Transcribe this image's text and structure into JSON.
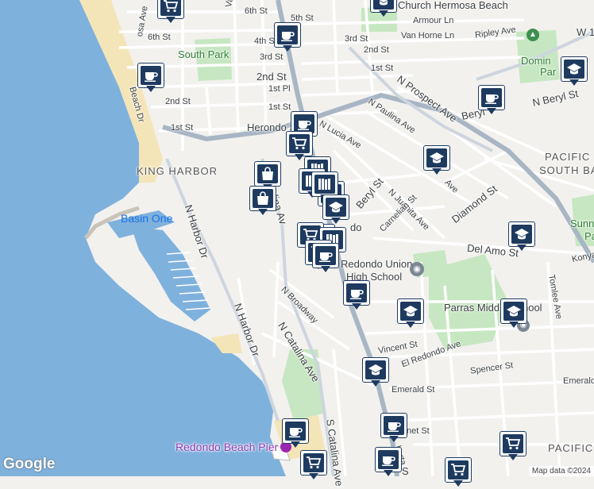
{
  "map": {
    "colors": {
      "ocean": "#7fb1dd",
      "land": "#f2f1ee",
      "sand": "#f4e5b9",
      "park": "#c6e7c1",
      "road_major": "#a8b6c4",
      "road_minor": "#ffffff"
    },
    "labels": {
      "street_6th_a": "6th St",
      "street_6th_b": "6th St",
      "street_5th": "5th St",
      "church": "Church Hermosa Beach",
      "armour": "Armour Ln",
      "valley": "Valley Dr",
      "hermosa_ave": "osa Ave",
      "street_4th": "4th St",
      "street_3rd_a": "3rd St",
      "street_3rd_b": "3rd St",
      "van_horne": "Van Horne Ln",
      "ripley": "Ripley Ave",
      "w1": "W 1",
      "south_park": "South Park",
      "street_2nd_a": "2nd St",
      "street_2nd_b": "2nd St",
      "street_2nd_c": "2nd St",
      "street_1st_a": "1st St",
      "street_1st_b": "1st St",
      "street_1st_c": "1st St",
      "first_pl": "1st Pl",
      "beach_dr": "Beach Dr",
      "n_prospect": "N Prospect Ave",
      "n_beryl": "N Beryl St",
      "beryl": "Beryl",
      "n_paulina": "N Paulina Ave",
      "herondo": "Herondo St",
      "lucia": "N Lucia Ave",
      "king_harbor": "KING HARBOR",
      "pacific_south_bay_1": "PACIFIC",
      "pacific_south_bay_2": "SOUTH BAY",
      "n_catalina": "N Catalina Av",
      "beryl_st": "Beryl St",
      "n_juanita": "N Juanita Ave",
      "diamond": "Diamond St",
      "basin_one": "Basin One",
      "n_harbor_1": "N Harbor Dr",
      "do": "do",
      "carnelian": "Carnelian St",
      "del_amo": "Del Amo St",
      "konya": "Konya",
      "sunn": "Sunn",
      "pa": "Pa",
      "rhs_1": "Redondo Union",
      "rhs_2": "High School",
      "n_broadway": "N Broadway",
      "parras": "Parras Middle School",
      "tomlee": "Tomlee Ave",
      "n_harbor_2": "N Harbor Dr",
      "n_catalina_2": "N Catalina Ave",
      "vincent": "Vincent St",
      "el_redondo": "El Redondo Ave",
      "spencer": "Spencer St",
      "emerald_1": "Emerald St",
      "emerald_2": "Emerald",
      "garnet": "net St",
      "s_catalina": "S Catalina Ave",
      "berta": "berta",
      "pacific_2": "PACIFIC",
      "pier": "Redondo Beach Pier",
      "dominguez": "Domin",
      "par": "Par",
      "ave": "Ave",
      "smith": "S"
    },
    "google": "Google",
    "attribution": "Map data ©2024"
  }
}
